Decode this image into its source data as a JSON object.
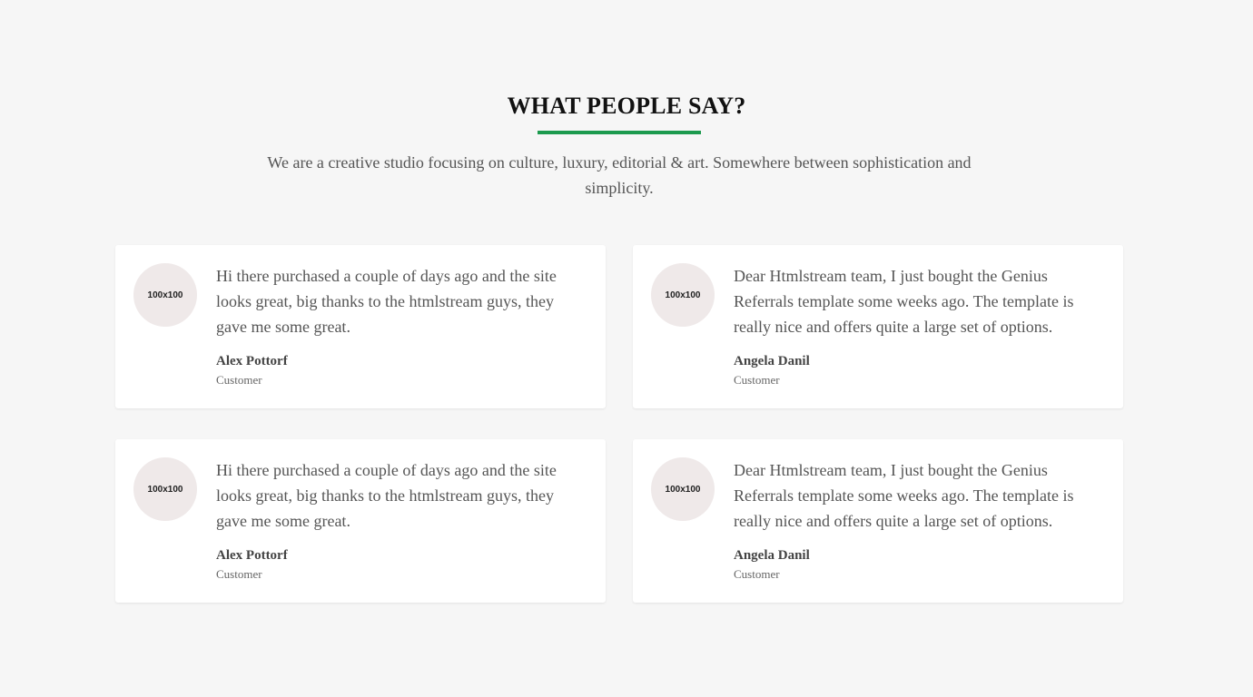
{
  "section": {
    "title": "WHAT PEOPLE SAY?",
    "subtitle": "We are a creative studio focusing on culture, luxury, editorial & art. Somewhere between sophistication and simplicity.",
    "accent_color": "#1c9a4e"
  },
  "testimonials": [
    {
      "avatar_text": "100x100",
      "quote": "Hi there purchased a couple of days ago and the site looks great, big thanks to the htmlstream guys, they gave me some great.",
      "name": "Alex Pottorf",
      "role": "Customer"
    },
    {
      "avatar_text": "100x100",
      "quote": "Dear Htmlstream team, I just bought the Genius Referrals template some weeks ago. The template is really nice and offers quite a large set of options.",
      "name": "Angela Danil",
      "role": "Customer"
    },
    {
      "avatar_text": "100x100",
      "quote": "Hi there purchased a couple of days ago and the site looks great, big thanks to the htmlstream guys, they gave me some great.",
      "name": "Alex Pottorf",
      "role": "Customer"
    },
    {
      "avatar_text": "100x100",
      "quote": "Dear Htmlstream team, I just bought the Genius Referrals template some weeks ago. The template is really nice and offers quite a large set of options.",
      "name": "Angela Danil",
      "role": "Customer"
    }
  ]
}
